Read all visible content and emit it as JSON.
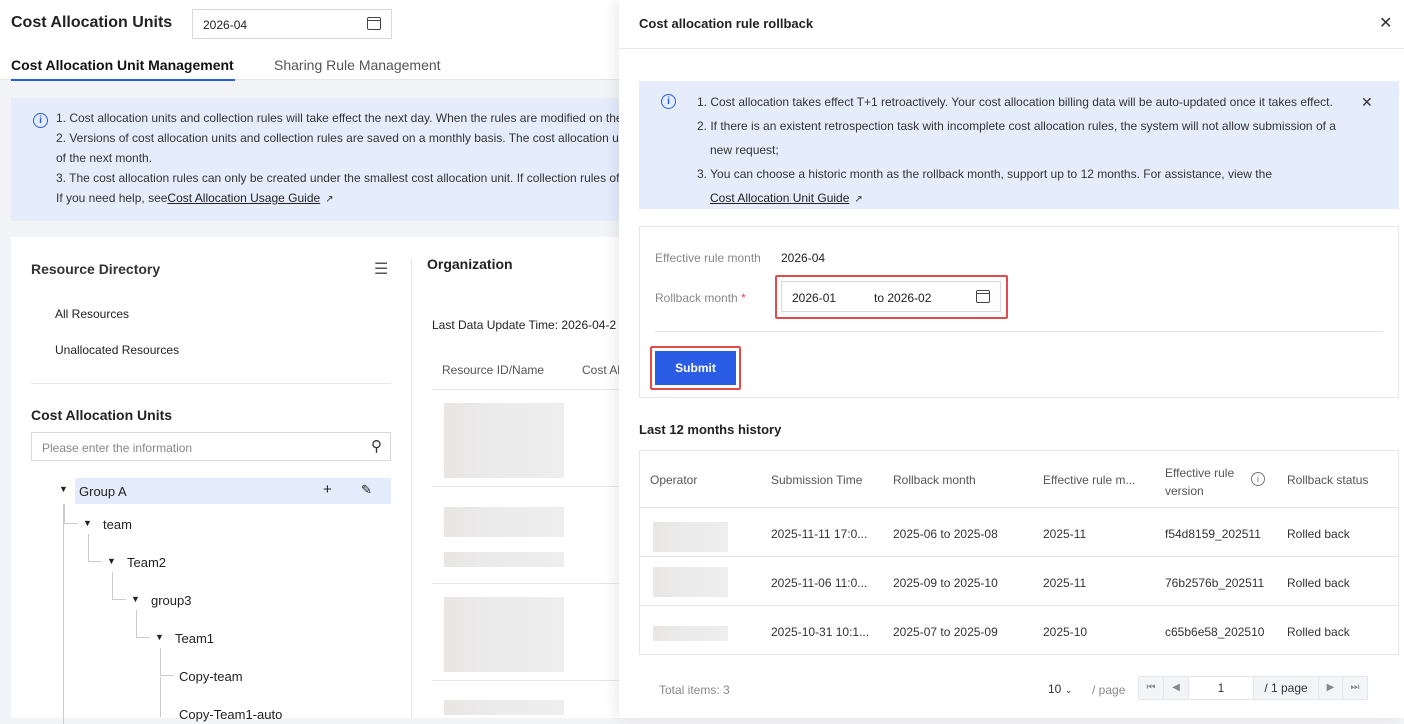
{
  "header": {
    "title": "Cost Allocation Units",
    "month": "2026-04"
  },
  "tabs": [
    {
      "label": "Cost Allocation Unit Management",
      "active": true
    },
    {
      "label": "Sharing Rule Management",
      "active": false
    }
  ],
  "notice": {
    "lines": [
      "1. Cost allocation units and collection rules will take effect the next day. When the rules are modified on the",
      "2. Versions of cost allocation units and collection rules are saved on a monthly basis. The cost allocation u",
      "of the next month.",
      "3. The cost allocation rules can only be created under the smallest cost allocation unit. If collection rules of"
    ],
    "help_prefix": "If you need help, see",
    "help_link": "Cost Allocation Usage Guide"
  },
  "resource_directory": {
    "title": "Resource Directory",
    "items": [
      "All Resources",
      "Unallocated Resources"
    ]
  },
  "cost_units": {
    "title": "Cost Allocation Units",
    "search_placeholder": "Please enter the information",
    "tree": [
      "Group A",
      "team",
      "Team2",
      "group3",
      "Team1",
      "Copy-team",
      "Copy-Team1-auto"
    ]
  },
  "organization": {
    "title": "Organization",
    "last_update_label": "Last Data Update Time:",
    "last_update_value": "2026-04-2",
    "columns": [
      "Resource ID/Name",
      "Cost Al"
    ]
  },
  "drawer": {
    "title": "Cost allocation rule rollback",
    "notice": [
      "1. Cost allocation takes effect T+1 retroactively. Your cost allocation billing data will be auto-updated once it takes effect.",
      "2. If there is an existent retrospection task with incomplete cost allocation rules, the system will not allow submission of a",
      "new request;",
      "3. You can choose a historic month as the rollback month, support up to 12 months. For assistance, view the"
    ],
    "notice_link": "Cost Allocation Unit Guide",
    "effective_label": "Effective rule month",
    "effective_value": "2026-04",
    "rollback_label": "Rollback month",
    "rollback_required": "*",
    "rollback_from": "2026-01",
    "rollback_to": "to 2026-02",
    "submit": "Submit",
    "history_title": "Last 12 months history",
    "columns": [
      "Operator",
      "Submission Time",
      "Rollback month",
      "Effective rule m...",
      "Effective rule version",
      "Rollback status"
    ],
    "rows": [
      {
        "time": "2025-11-11 17:0...",
        "month": "2025-06 to 2025-08",
        "eff": "2025-11",
        "ver": "f54d8159_202511",
        "status": "Rolled back"
      },
      {
        "time": "2025-11-06 11:0...",
        "month": "2025-09 to 2025-10",
        "eff": "2025-11",
        "ver": "76b2576b_202511",
        "status": "Rolled back"
      },
      {
        "time": "2025-10-31 10:1...",
        "month": "2025-07 to 2025-09",
        "eff": "2025-10",
        "ver": "c65b6e58_202510",
        "status": "Rolled back"
      }
    ],
    "total": "Total items: 3",
    "page_size": "10",
    "per_page": "/ page",
    "page": "1",
    "page_total": "/ 1 page"
  }
}
